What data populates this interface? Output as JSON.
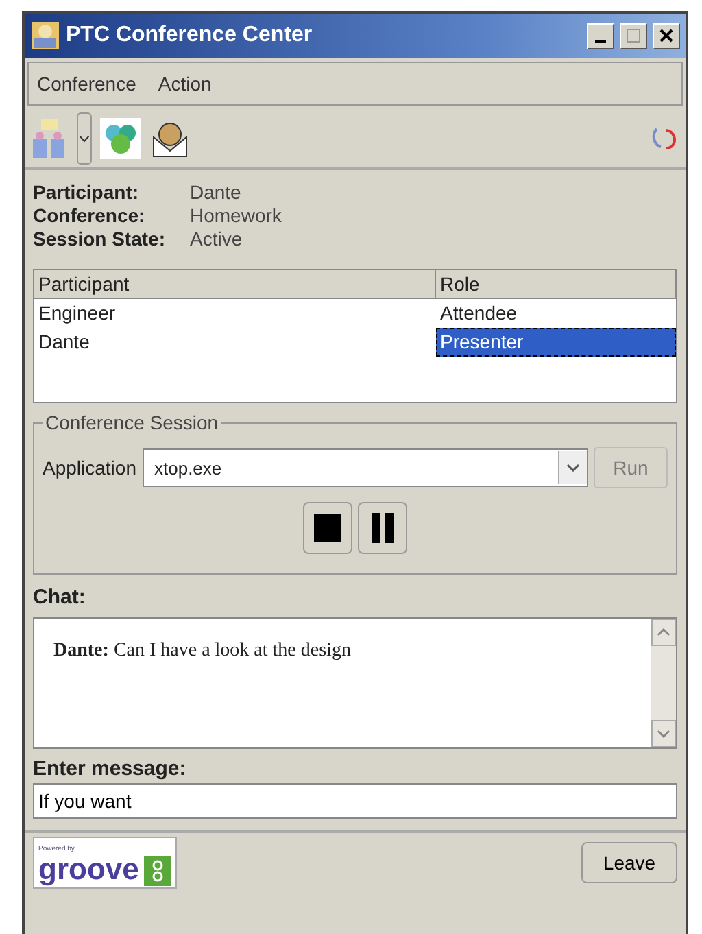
{
  "window": {
    "title": "PTC Conference Center"
  },
  "menu": [
    "Conference",
    "Action"
  ],
  "info": [
    {
      "label": "Participant:",
      "value": "Dante"
    },
    {
      "label": "Conference:",
      "value": "Homework"
    },
    {
      "label": "Session State:",
      "value": "Active"
    }
  ],
  "table": {
    "columns": [
      "Participant",
      "Role"
    ],
    "rows": [
      {
        "cells": [
          "Engineer",
          "Attendee"
        ],
        "selected": false
      },
      {
        "cells": [
          "Dante",
          "Presenter"
        ],
        "selected": true
      }
    ]
  },
  "session": {
    "title": "Conference Session",
    "label": "Application",
    "value": "xtop.exe",
    "run": {
      "label": "Run",
      "disabled": true
    }
  },
  "chat": {
    "label": "Chat:",
    "messages": [
      {
        "author": "Dante:",
        "text": "Can I have a look at the design"
      }
    ]
  },
  "message": {
    "label": "Enter message:",
    "value": "If you want"
  },
  "footer": {
    "logo_caption": "Powered by",
    "logo": "groove",
    "leave": "Leave"
  }
}
